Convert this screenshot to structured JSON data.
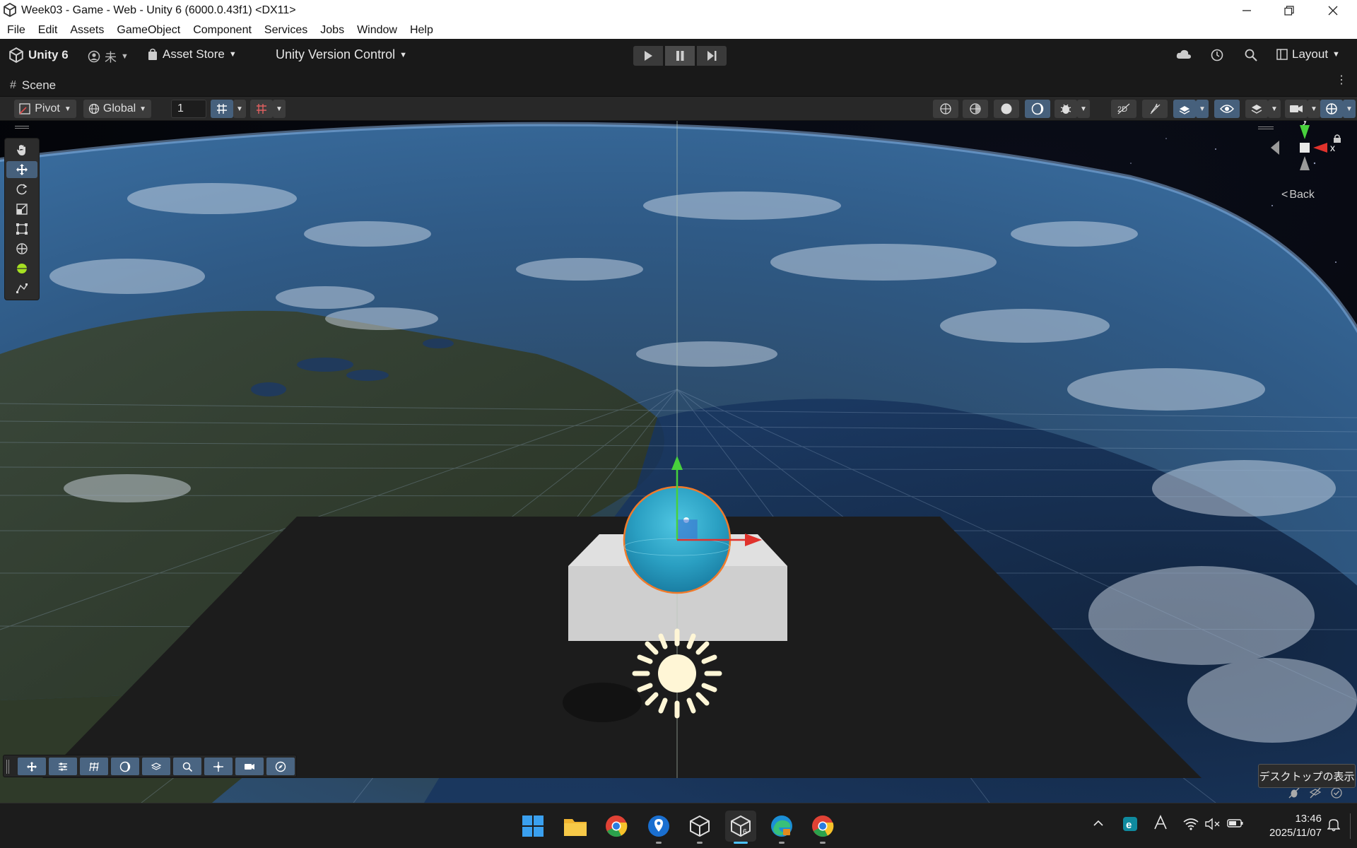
{
  "window": {
    "title": "Week03 - Game - Web - Unity 6 (6000.0.43f1) <DX11>",
    "minimize_icon": "minimize-icon",
    "maximize_icon": "restore-icon",
    "close_icon": "close-icon"
  },
  "menu": {
    "items": [
      "File",
      "Edit",
      "Assets",
      "GameObject",
      "Component",
      "Services",
      "Jobs",
      "Window",
      "Help"
    ]
  },
  "toolbar": {
    "brand": "Unity 6",
    "account": "未",
    "asset_store": "Asset Store",
    "version_control": "Unity Version Control",
    "layout": "Layout"
  },
  "scene_tab": {
    "label": "Scene"
  },
  "scene_toolbar": {
    "pivot": "Pivot",
    "global": "Global",
    "grid_snap_value": "1"
  },
  "gizmo": {
    "y_label": "y",
    "x_label": "x",
    "view_label": "Back"
  },
  "tooltip": {
    "text": "デスクトップの表示"
  },
  "clock": {
    "time": "13:46",
    "date": "2025/11/07"
  },
  "colors": {
    "accent": "#46607c",
    "axis_y": "#48d13c",
    "axis_x": "#e0322c",
    "sphere": "#2aa8c8",
    "selection_outline": "#f07a2a"
  }
}
